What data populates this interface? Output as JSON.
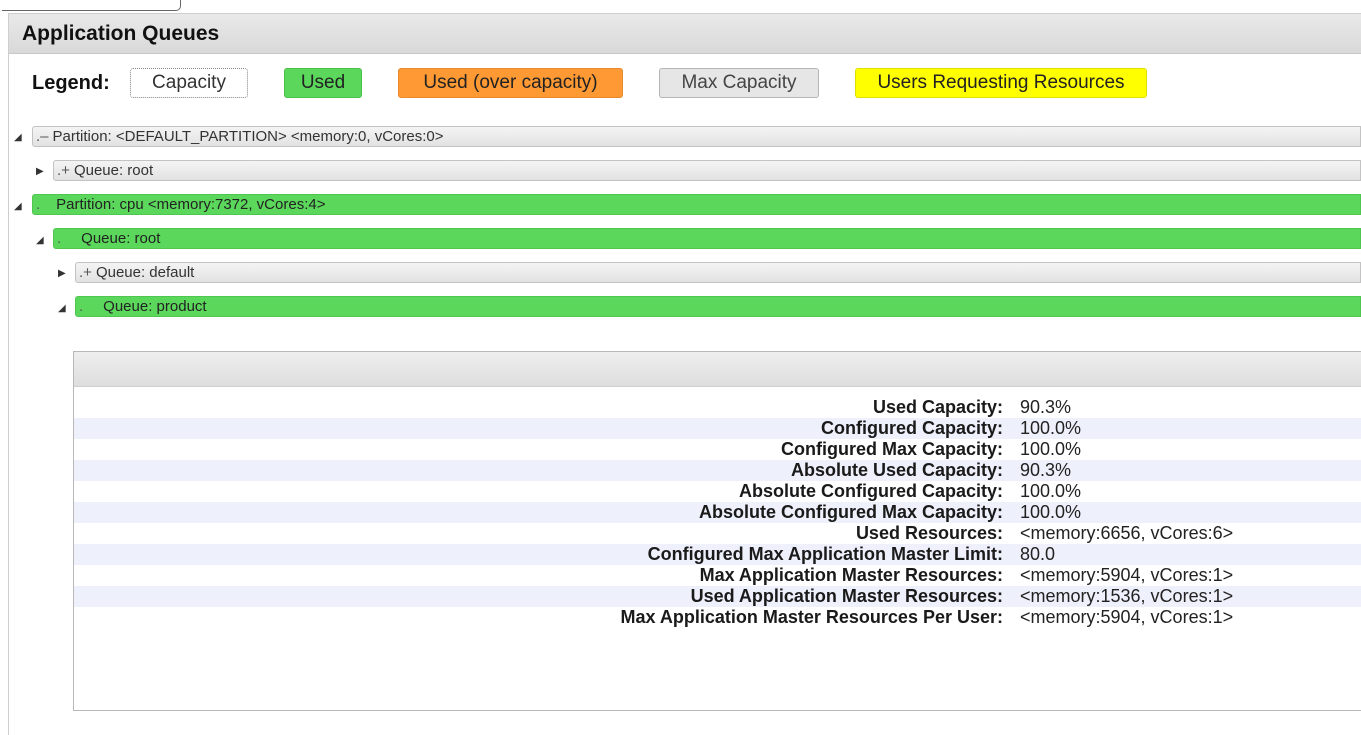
{
  "header": {
    "title": "Application Queues"
  },
  "legend": {
    "title": "Legend:",
    "items": [
      {
        "label": "Capacity",
        "color": "#ffffff"
      },
      {
        "label": "Used",
        "color": "#5bd85b"
      },
      {
        "label": "Used (over capacity)",
        "color": "#ff9933"
      },
      {
        "label": "Max Capacity",
        "color": "#e6e6e6"
      },
      {
        "label": "Users Requesting Resources",
        "color": "#ffff00"
      }
    ]
  },
  "tree": [
    {
      "prefix": ".–",
      "label": "Partition: <DEFAULT_PARTITION> <memory:0, vCores:0>",
      "expanded": true,
      "used": false
    },
    {
      "prefix": ".+",
      "label": "Queue: root",
      "expanded": false,
      "used": false
    },
    {
      "prefix": ".",
      "label": "Partition: cpu <memory:7372, vCores:4>",
      "expanded": true,
      "used": true
    },
    {
      "prefix": ".",
      "label": "Queue: root",
      "expanded": true,
      "used": true
    },
    {
      "prefix": ".+",
      "label": "Queue: default",
      "expanded": false,
      "used": false
    },
    {
      "prefix": ".",
      "label": "Queue: product",
      "expanded": true,
      "used": true
    }
  ],
  "details": [
    {
      "key": "Used Capacity:",
      "value": "90.3%"
    },
    {
      "key": "Configured Capacity:",
      "value": "100.0%"
    },
    {
      "key": "Configured Max Capacity:",
      "value": "100.0%"
    },
    {
      "key": "Absolute Used Capacity:",
      "value": "90.3%"
    },
    {
      "key": "Absolute Configured Capacity:",
      "value": "100.0%"
    },
    {
      "key": "Absolute Configured Max Capacity:",
      "value": "100.0%"
    },
    {
      "key": "Used Resources:",
      "value": "<memory:6656, vCores:6>"
    },
    {
      "key": "Configured Max Application Master Limit:",
      "value": "80.0"
    },
    {
      "key": "Max Application Master Resources:",
      "value": "<memory:5904, vCores:1>"
    },
    {
      "key": "Used Application Master Resources:",
      "value": "<memory:1536, vCores:1>"
    },
    {
      "key": "Max Application Master Resources Per User:",
      "value": "<memory:5904, vCores:1>"
    }
  ]
}
